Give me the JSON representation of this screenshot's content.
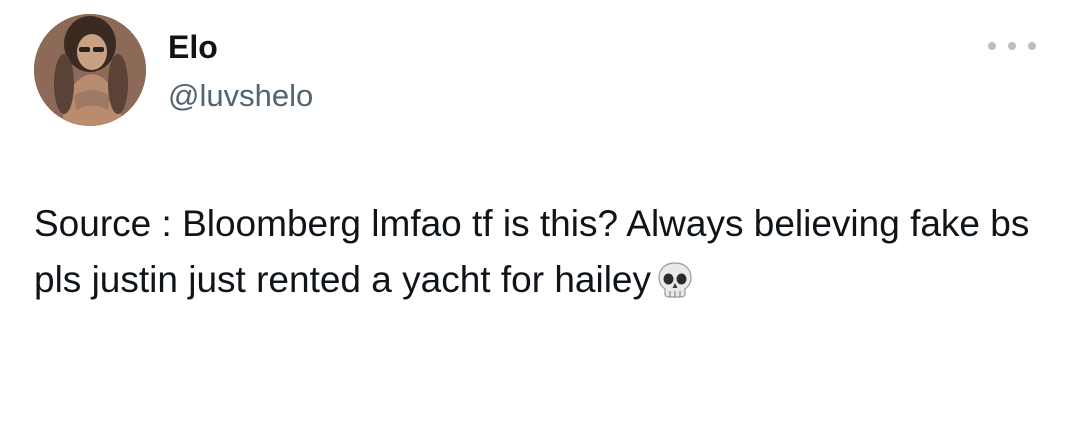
{
  "tweet": {
    "display_name": "Elo",
    "handle": "@luvshelo",
    "text": "Source  : Bloomberg lmfao tf is this? Always believing fake bs pls justin just rented a yacht for hailey",
    "emoji": "skull-icon"
  },
  "menu": {
    "icon": "more-horizontal-icon"
  },
  "colors": {
    "text": "#0f1419",
    "secondary": "#536471",
    "dots": "#b7c0c7"
  }
}
